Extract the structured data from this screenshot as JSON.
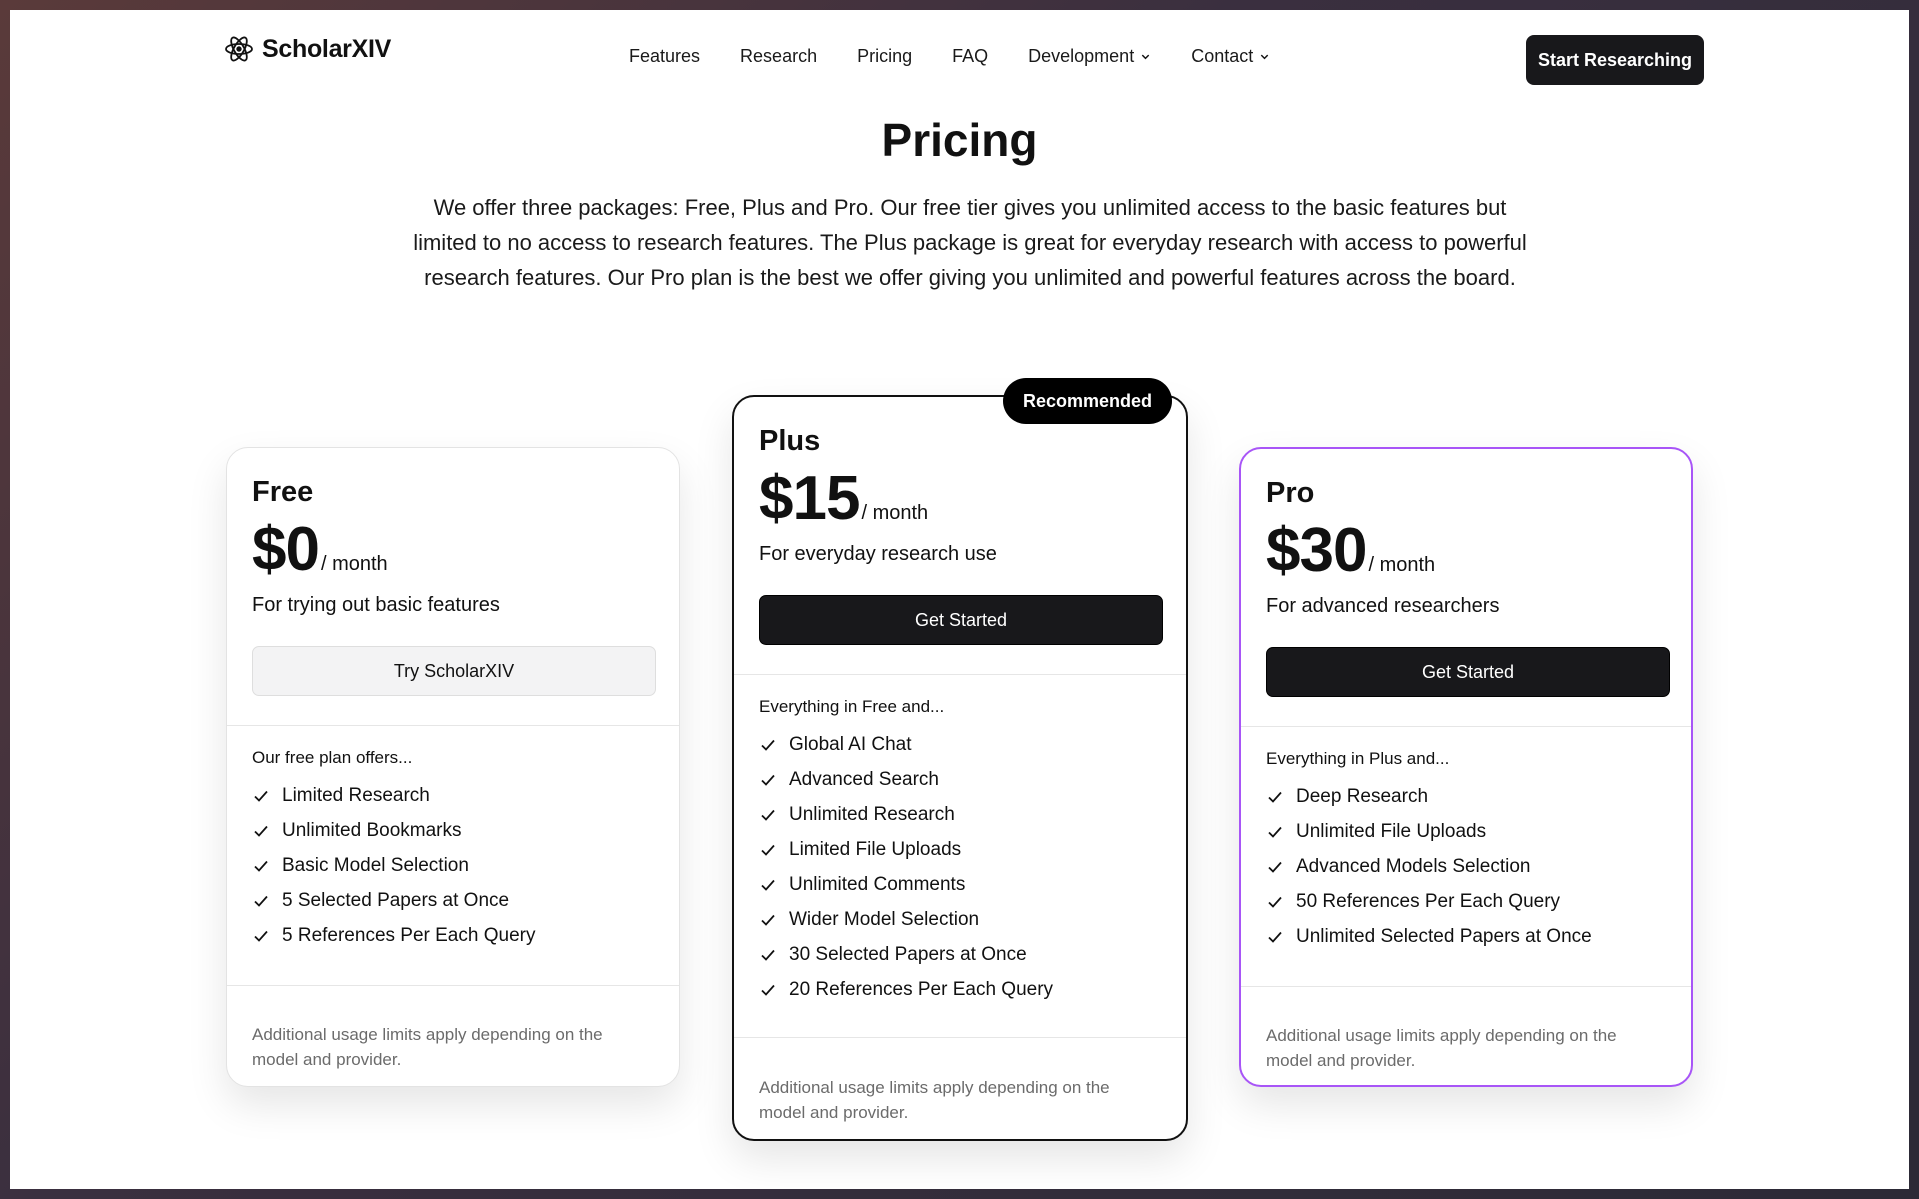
{
  "header": {
    "brand": "ScholarXIV",
    "nav": [
      {
        "label": "Features",
        "dropdown": false
      },
      {
        "label": "Research",
        "dropdown": false
      },
      {
        "label": "Pricing",
        "dropdown": false
      },
      {
        "label": "FAQ",
        "dropdown": false
      },
      {
        "label": "Development",
        "dropdown": true
      },
      {
        "label": "Contact",
        "dropdown": true
      }
    ],
    "cta_label": "Start Researching"
  },
  "hero": {
    "title": "Pricing",
    "intro": "We offer three packages: Free, Plus and Pro. Our free tier gives you unlimited access to the basic features but limited to no access to research features. The Plus package is great for everyday research with access to powerful research features. Our Pro plan is the best we offer giving you unlimited and powerful features across the board."
  },
  "plans": {
    "free": {
      "name": "Free",
      "price": "$0",
      "period": "/ month",
      "tagline": "For trying out basic features",
      "button": "Try ScholarXIV",
      "features_intro": "Our free plan offers...",
      "features": [
        "Limited Research",
        "Unlimited Bookmarks",
        "Basic Model Selection",
        "5 Selected Papers at Once",
        "5 References Per Each Query"
      ],
      "note": "Additional usage limits apply depending on the model and provider."
    },
    "plus": {
      "badge": "Recommended",
      "name": "Plus",
      "price": "$15",
      "period": "/ month",
      "tagline": "For everyday research use",
      "button": "Get Started",
      "features_intro": "Everything in Free and...",
      "features": [
        "Global AI Chat",
        "Advanced Search",
        "Unlimited Research",
        "Limited File Uploads",
        "Unlimited Comments",
        "Wider Model Selection",
        "30 Selected Papers at Once",
        "20 References Per Each Query"
      ],
      "note": "Additional usage limits apply depending on the model and provider."
    },
    "pro": {
      "name": "Pro",
      "price": "$30",
      "period": "/ month",
      "tagline": "For advanced researchers",
      "button": "Get Started",
      "features_intro": "Everything in Plus and...",
      "features": [
        "Deep Research",
        "Unlimited File Uploads",
        "Advanced Models Selection",
        "50 References Per Each Query",
        "Unlimited Selected Papers at Once"
      ],
      "note": "Additional usage limits apply depending on the model and provider."
    }
  },
  "colors": {
    "primary": "#18181b",
    "pro_accent": "#a855f7",
    "muted_text": "#6b6b6b"
  },
  "icons": {
    "logo": "atom-icon",
    "feature": "check-icon",
    "dropdown": "chevron-down-icon"
  }
}
